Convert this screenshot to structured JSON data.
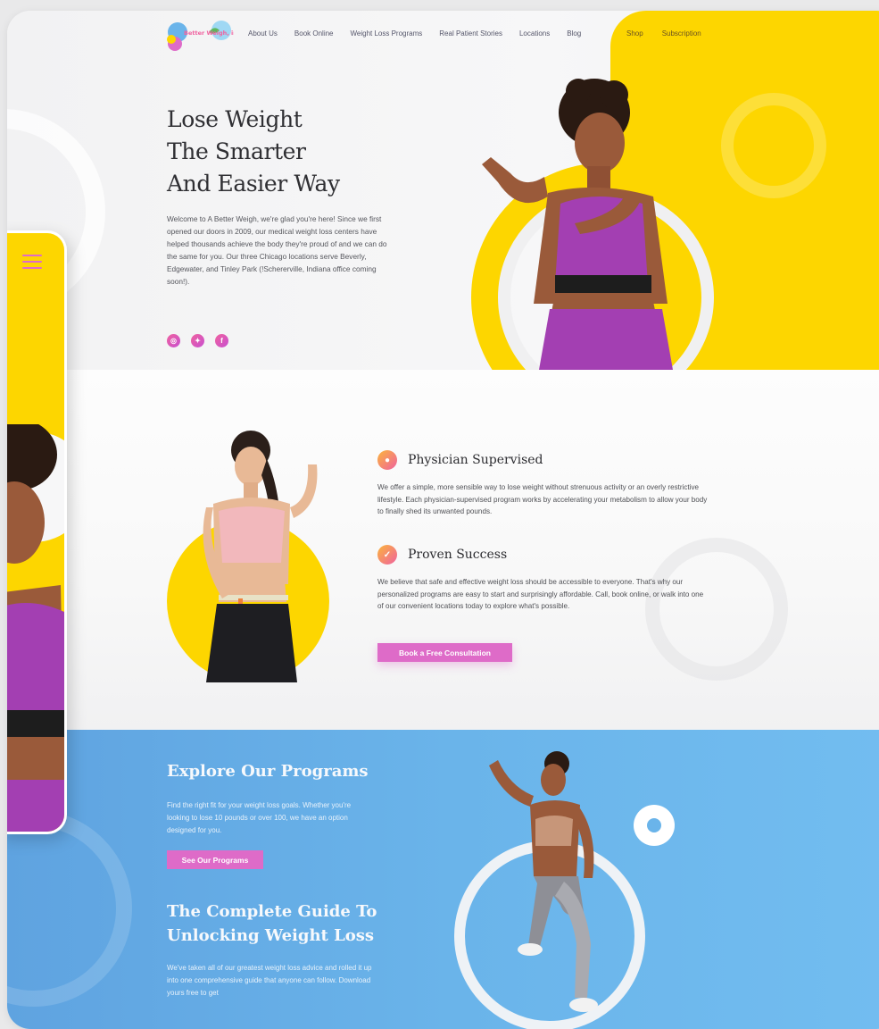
{
  "brand": {
    "logo_text": "Better Weigh, inc",
    "colors": {
      "yellow": "#fdd600",
      "pink": "#de6bc8",
      "blue": "#6ab4ea"
    }
  },
  "nav": {
    "items": [
      "About Us",
      "Book Online",
      "Weight Loss Programs",
      "Real Patient Stories",
      "Locations",
      "Blog"
    ],
    "right_items": [
      "Shop",
      "Subscription"
    ]
  },
  "hero": {
    "title_lines": [
      "Lose Weight",
      "The Smarter",
      "And Easier Way"
    ],
    "intro": "Welcome to A Better Weigh, we're glad you're here! Since we first opened our doors in 2009, our medical weight loss centers have helped thousands achieve the body they're proud of and we can do the same for you. Our three Chicago locations serve Beverly, Edgewater, and Tinley Park (!Schererville, Indiana office coming soon!).",
    "socials": [
      "instagram-icon",
      "twitter-icon",
      "facebook-icon"
    ]
  },
  "features": {
    "items": [
      {
        "icon": "eye-icon",
        "title": "Physician Supervised",
        "text": "We offer a simple, more sensible way to lose weight without strenuous activity or an overly restrictive lifestyle. Each physician-supervised program works by accelerating your metabolism to allow your body to finally shed its unwanted pounds."
      },
      {
        "icon": "check-icon",
        "title": "Proven Success",
        "text": "We believe that safe and effective weight loss should be accessible to everyone. That's why our personalized programs are easy to start and surprisingly affordable. Call, book online, or walk into one of our convenient locations today to explore what's possible."
      }
    ],
    "cta_label": "Book a Free Consultation"
  },
  "programs": {
    "title": "Explore Our Programs",
    "text": "Find the right fit for your weight loss goals. Whether you're looking to lose 10 pounds or over 100, we have an option designed for you.",
    "button_label": "See Our Programs"
  },
  "guide": {
    "title_lines": [
      "The Complete Guide To",
      "Unlocking Weight Loss"
    ],
    "text": "We've taken all of our greatest weight loss advice and rolled it up into one comprehensive guide that anyone can follow. Download yours free to get"
  }
}
